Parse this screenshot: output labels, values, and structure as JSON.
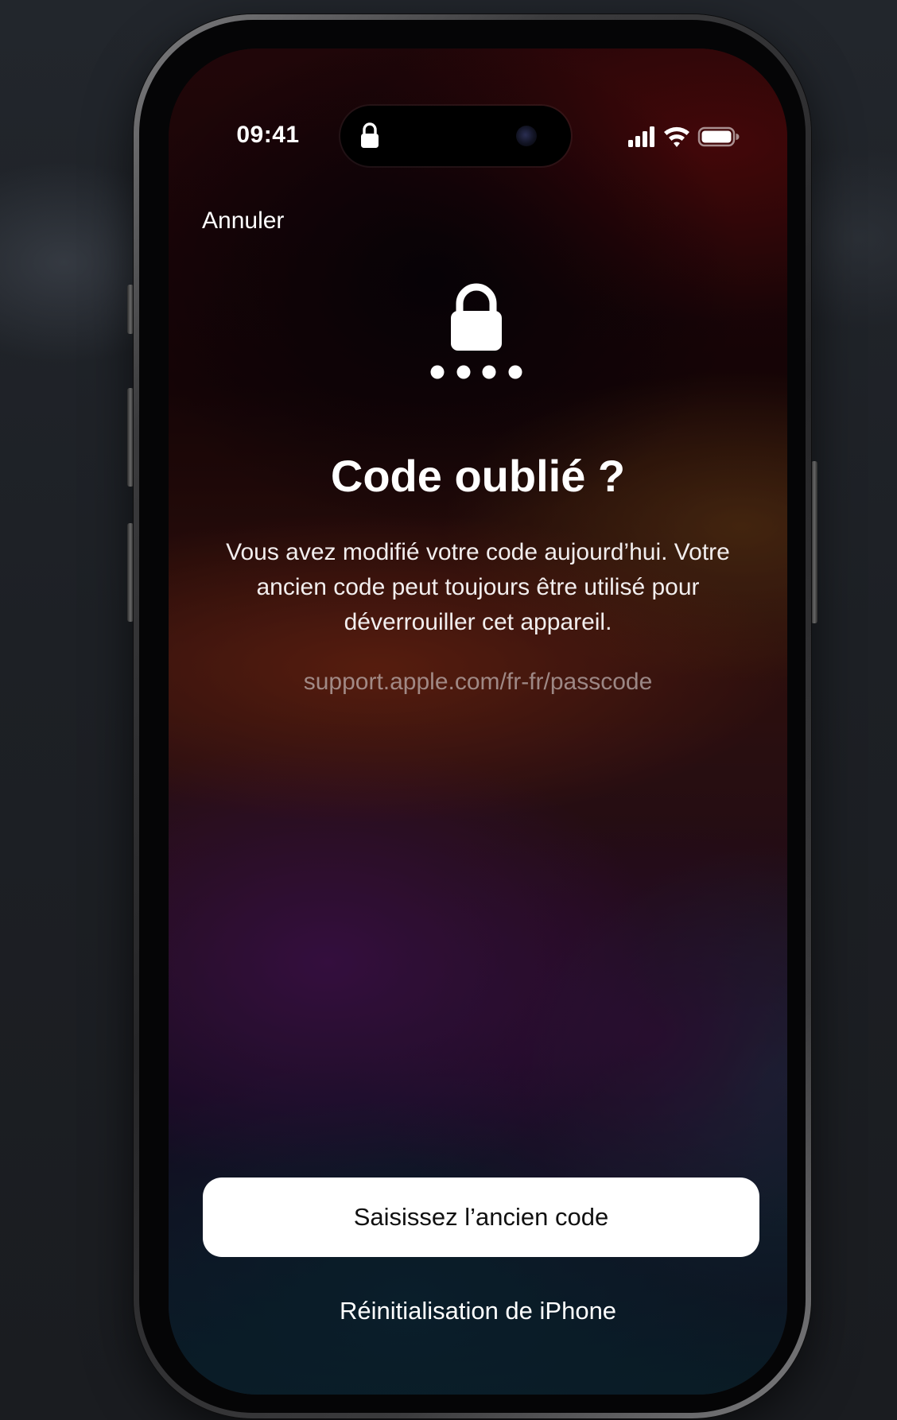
{
  "status_bar": {
    "time": "09:41",
    "icons": [
      "lock-icon",
      "signal-icon",
      "wifi-icon",
      "battery-icon"
    ]
  },
  "nav": {
    "cancel_label": "Annuler"
  },
  "hero": {
    "icon": "lock-passcode-icon",
    "title": "Code oublié ?"
  },
  "message": {
    "body": "Vous avez modifié votre code aujourd’hui. Votre ancien code peut toujours être utilisé pour déverrouiller cet appareil.",
    "link": "support.apple.com/fr-fr/passcode"
  },
  "actions": {
    "primary_label": "Saisissez l’ancien code",
    "secondary_label": "Réinitialisation de iPhone"
  },
  "colors": {
    "text": "#ffffff",
    "link_muted": "#c8bebe",
    "button_bg": "#ffffff",
    "button_text": "#111111"
  }
}
